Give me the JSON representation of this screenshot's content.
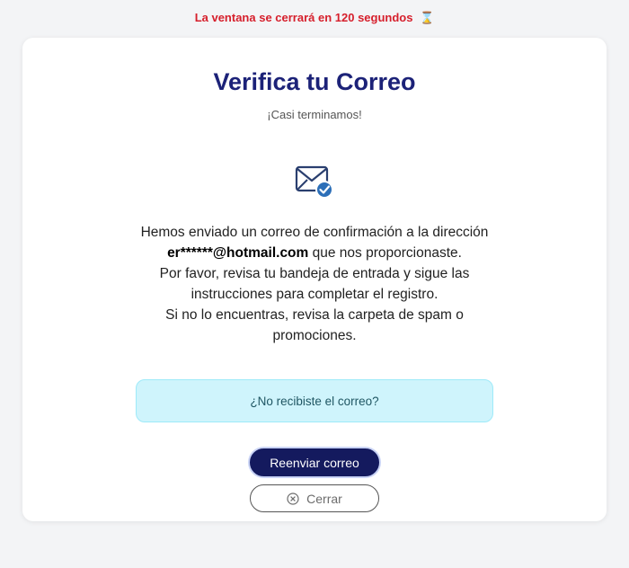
{
  "timer": {
    "text": "La ventana se cerrará en 120 segundos",
    "icon": "hourglass-icon",
    "icon_glyph": "⌛"
  },
  "card": {
    "title": "Verifica tu Correo",
    "subtitle": "¡Casi terminamos!",
    "icon": "envelope-check-icon",
    "message": {
      "line1_prefix": "Hemos enviado un correo de confirmación a la dirección ",
      "email": "er******@hotmail.com",
      "line1_suffix": " que nos proporcionaste.",
      "line2": "Por favor, revisa tu bandeja de entrada y sigue las instrucciones para completar el registro.",
      "line3": "Si no lo encuentras, revisa la carpeta de spam o promociones."
    },
    "notice": "¿No recibiste el correo?",
    "resend_button": "Reenviar correo",
    "close_button": "Cerrar"
  },
  "colors": {
    "title": "#1c2278",
    "timer": "#d61f2c",
    "primary_button": "#141a5e",
    "notice_bg": "#cff4fc",
    "icon_check": "#2c6fb8"
  }
}
